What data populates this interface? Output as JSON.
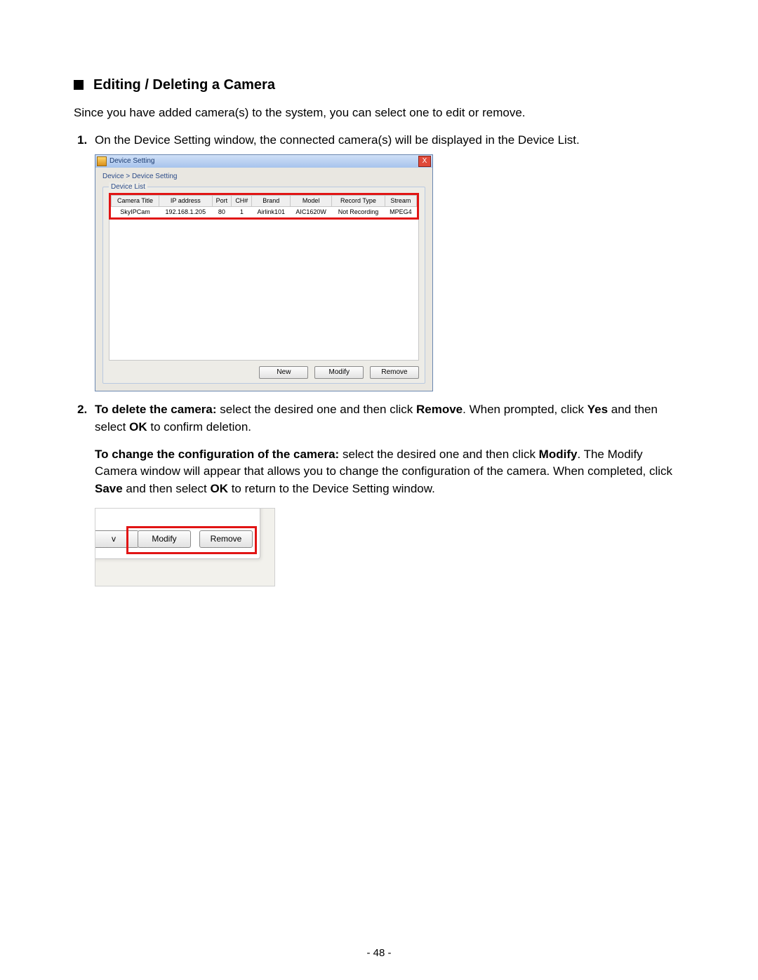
{
  "heading": "Editing / Deleting a Camera",
  "intro": "Since you have added camera(s) to the system, you can select one to edit or remove.",
  "step1": "On the Device Setting window, the connected camera(s) will be displayed in the Device List.",
  "step2": {
    "delete_lead": "To delete the camera:",
    "delete_body_a": " select the desired one and then click ",
    "delete_remove": "Remove",
    "delete_body_b": ". When prompted, click ",
    "delete_yes": "Yes",
    "delete_body_c": " and then select ",
    "delete_ok": "OK",
    "delete_body_d": " to confirm deletion.",
    "modify_lead": "To change the configuration of the camera:",
    "modify_body_a": " select the desired one and then click ",
    "modify_modify": "Modify",
    "modify_body_b": ". The Modify Camera window will appear that allows you to change the configuration of the camera. When completed, click ",
    "modify_save": "Save",
    "modify_body_c": " and then select ",
    "modify_ok": "OK",
    "modify_body_d": " to return to the Device Setting window."
  },
  "window": {
    "title": "Device Setting",
    "breadcrumb": "Device > Device Setting",
    "group_label": "Device List",
    "close_glyph": "X",
    "headers": {
      "camera_title": "Camera Title",
      "ip": "IP address",
      "port": "Port",
      "ch": "CH#",
      "brand": "Brand",
      "model": "Model",
      "record_type": "Record Type",
      "stream": "Stream"
    },
    "row": {
      "camera_title": "SkyIPCam",
      "ip": "192.168.1.205",
      "port": "80",
      "ch": "1",
      "brand": "Airlink101",
      "model": "AIC1620W",
      "record_type": "Not Recording",
      "stream": "MPEG4"
    },
    "buttons": {
      "new": "New",
      "modify": "Modify",
      "remove": "Remove"
    }
  },
  "closeup": {
    "cut_button_fragment": "v",
    "modify": "Modify",
    "remove": "Remove"
  },
  "page_number": "- 48 -"
}
